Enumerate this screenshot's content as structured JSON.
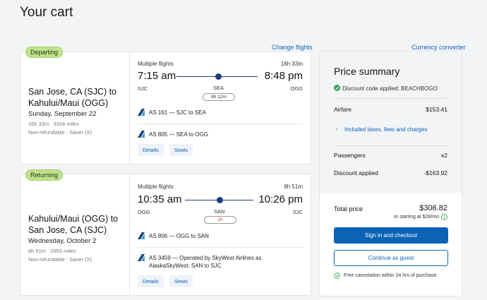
{
  "page": {
    "title": "Your cart",
    "change_flights": "Change flights",
    "currency_converter": "Currency converter"
  },
  "departing": {
    "badge": "Departing",
    "route": "San Jose, CA (SJC) to Kahului/Maui (OGG)",
    "date": "Sunday, September 22",
    "duration_miles": "16h 33m   3334 miles",
    "fare": "Non-refundable - Saver (X)",
    "multiple_flights": "Multiple flights",
    "total_duration": "16h 33m",
    "depart_time": "7:15 am",
    "arrive_time": "8:48 pm",
    "origin": "SJC",
    "stop": "SEA",
    "destination": "OGG",
    "layover": "8h 12m",
    "segments": [
      "AS 161 — SJC to SEA",
      "AS 805 — SEA to OGG"
    ],
    "details_label": "Details",
    "seats_label": "Seats"
  },
  "returning": {
    "badge": "Returning",
    "route": "Kahului/Maui (OGG) to San Jose, CA (SJC)",
    "date": "Wednesday, October 2",
    "duration_miles": "8h 51m   2953 miles",
    "fare": "Non-refundable - Saver (X)",
    "multiple_flights": "Multiple flights",
    "total_duration": "8h 51m",
    "depart_time": "10:35 am",
    "arrive_time": "10:26 pm",
    "origin": "OGG",
    "stop": "SAN",
    "destination": "SJC",
    "layover": "2h",
    "segments": [
      "AS 806 — OGG to SAN",
      "AS 3459 — Operated by SkyWest Airlines as AlaskaSkyWest: SAN to SJC"
    ],
    "details_label": "Details",
    "seats_label": "Seats"
  },
  "summary": {
    "title": "Price summary",
    "discount_code": "Discount code applied: BEACHBOGO",
    "airfare_label": "Airfare",
    "airfare_value": "$153.41",
    "taxes_link": "Included taxes, fees and charges",
    "passengers_label": "Passengers",
    "passengers_value": "x2",
    "discount_label": "Discount applied",
    "discount_value": "-$163.92",
    "total_label": "Total price",
    "total_value": "$306.82",
    "monthly": "or starting at $28/mo",
    "signin_button": "Sign in and checkout",
    "guest_button": "Continue as guest",
    "free_cancel": "Free cancelation within 24 hrs of purchase"
  },
  "colors": {
    "accent": "#0b63b6",
    "badge": "#bfe28b",
    "navy": "#1b3f7a",
    "green": "#3aa35b"
  }
}
